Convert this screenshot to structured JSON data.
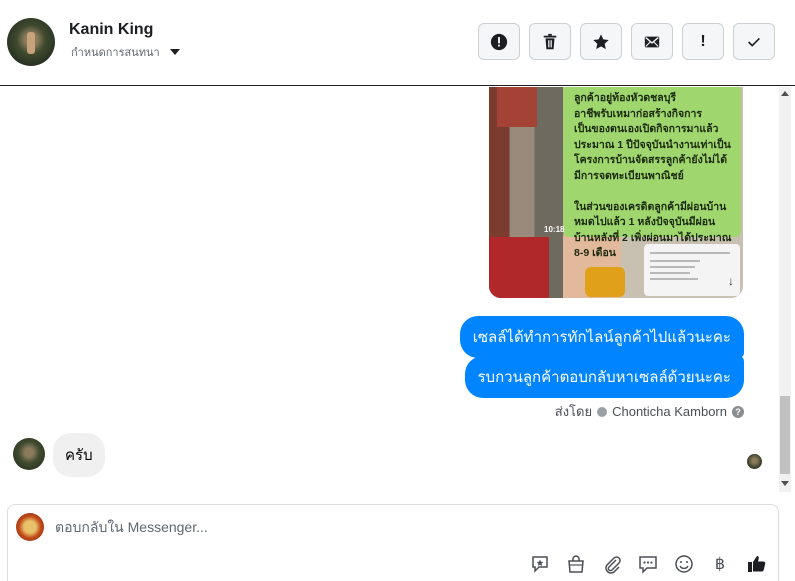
{
  "header": {
    "contact_name": "Kanin King",
    "conversation_label": "กำหนดการสนทนา",
    "actions": [
      {
        "name": "spam-icon",
        "glyph": "!"
      },
      {
        "name": "trash-icon",
        "glyph": ""
      },
      {
        "name": "star-icon",
        "glyph": ""
      },
      {
        "name": "mail-icon",
        "glyph": ""
      },
      {
        "name": "exclamation-icon",
        "glyph": "!"
      },
      {
        "name": "checkmark-icon",
        "glyph": "✓"
      }
    ]
  },
  "messages": {
    "image_text": "ลูกค้าอยู่ท้องหัวดชลบุรี\nอาชีพรับเหมาก่อสร้างกิจการ\nเป็นของตนเองเปิดกิจการมาแล้ว\nประมาณ 1 ปีปัจจุบันนำงานเท่าเป็น\nโครงการบ้านจัดสรรลูกค้ายังไม่ได้\nมีการจดทะเบียนพาณิชย์\n\nในส่วนของเครดิตลูกค้ามีผ่อนบ้าน\nหมดไปแล้ว 1 หลังปัจจุบันมีผ่อน\nบ้านหลังที่ 2 เพิ่งผ่อนมาได้ประมาณ\n8-9 เดือน",
    "image_time": "10:18",
    "outgoing": [
      "เซลล์ได้ทำการทักไลน์ลูกค้าไปแล้วนะคะ",
      "รบกวนลูกค้าตอบกลับหาเซลล์ด้วยนะคะ"
    ],
    "sent_by_prefix": "ส่งโดย",
    "sent_by_name": "Chonticha Kamborn",
    "help_glyph": "?",
    "incoming": "ครับ"
  },
  "composer": {
    "placeholder": "ตอบกลับใน Messenger...",
    "currency_glyph": "฿"
  },
  "colors": {
    "outgoing_bubble": "#0084ff",
    "incoming_bubble": "#f1f0f0",
    "like": "#1c1e21"
  }
}
